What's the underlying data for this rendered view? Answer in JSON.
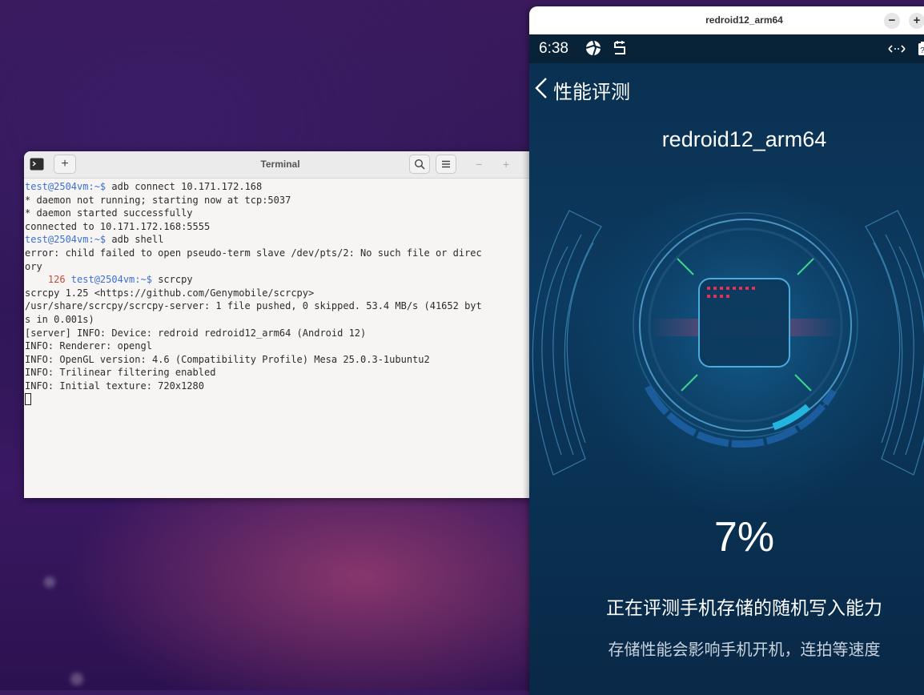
{
  "terminal": {
    "title": "Terminal",
    "lines": [
      {
        "user": "test@2504vm",
        "path": ":~$",
        "cmd": " adb connect 10.171.172.168"
      },
      {
        "text": "* daemon not running; starting now at tcp:5037"
      },
      {
        "text": "* daemon started successfully"
      },
      {
        "text": "connected to 10.171.172.168:5555"
      },
      {
        "user": "test@2504vm",
        "path": ":~$",
        "cmd": " adb shell"
      },
      {
        "text": "error: child failed to open pseudo-term slave /dev/pts/2: No such file or direc"
      },
      {
        "text": "ory"
      },
      {
        "code": "    126 ",
        "user": "test@2504vm",
        "path": ":~$",
        "cmd": " scrcpy"
      },
      {
        "text": "scrcpy 1.25 <https://github.com/Genymobile/scrcpy>"
      },
      {
        "text": "/usr/share/scrcpy/scrcpy-server: 1 file pushed, 0 skipped. 53.4 MB/s (41652 byt"
      },
      {
        "text": "s in 0.001s)"
      },
      {
        "text": "[server] INFO: Device: redroid redroid12_arm64 (Android 12)"
      },
      {
        "text": "INFO: Renderer: opengl"
      },
      {
        "text": "INFO: OpenGL version: 4.6 (Compatibility Profile) Mesa 25.0.3-1ubuntu2"
      },
      {
        "text": "INFO: Trilinear filtering enabled"
      },
      {
        "text": "INFO: Initial texture: 720x1280"
      }
    ]
  },
  "phone_window": {
    "title": "redroid12_arm64",
    "minimize_label": "−",
    "maximize_label": "+"
  },
  "android": {
    "time": "6:38",
    "page_title": "性能评测",
    "device_name": "redroid12_arm64",
    "progress_text": "7%",
    "progress": 0.07,
    "status_main": "正在评测手机存储的随机写入能力",
    "status_sub": "存储性能会影响手机开机，连拍等速度"
  }
}
